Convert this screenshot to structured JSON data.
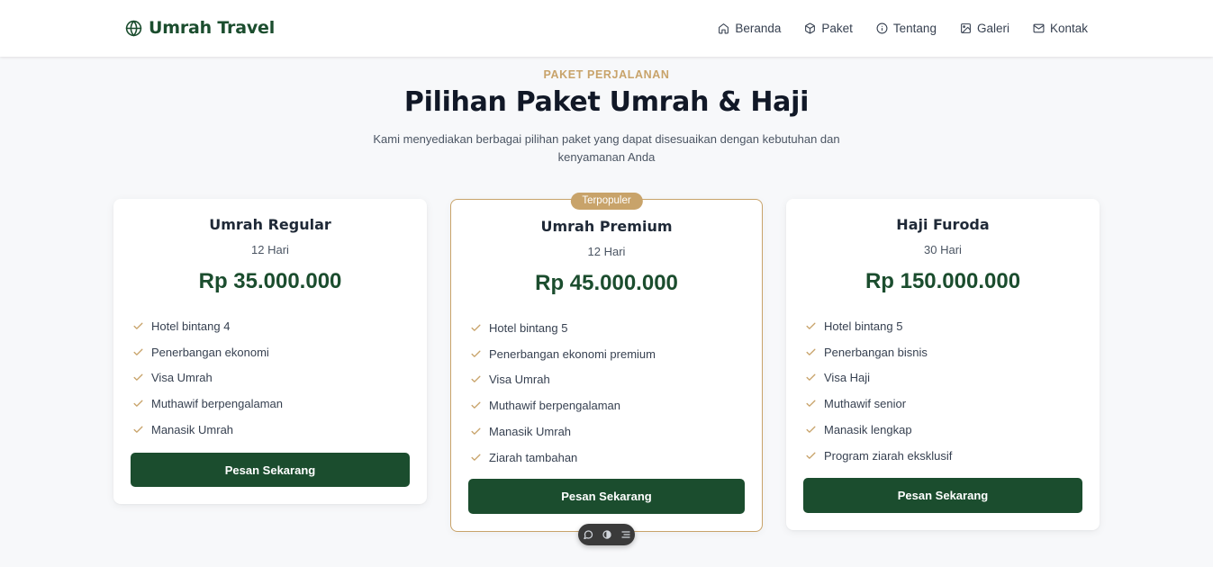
{
  "brand": {
    "name": "Umrah Travel",
    "icon": "globe-icon",
    "color": "#1b4d2e"
  },
  "nav": {
    "items": [
      {
        "label": "Beranda",
        "icon": "home-icon"
      },
      {
        "label": "Paket",
        "icon": "package-icon"
      },
      {
        "label": "Tentang",
        "icon": "info-icon"
      },
      {
        "label": "Galeri",
        "icon": "image-icon"
      },
      {
        "label": "Kontak",
        "icon": "mail-icon"
      }
    ]
  },
  "section": {
    "eyebrow": "PAKET PERJALANAN",
    "title": "Pilihan Paket Umrah & Haji",
    "subtitle": "Kami menyediakan berbagai pilihan paket yang dapat disesuaikan dengan kebutuhan dan kenyamanan Anda"
  },
  "packages": [
    {
      "title": "Umrah Regular",
      "duration": "12 Hari",
      "price": "Rp 35.000.000",
      "features": [
        "Hotel bintang 4",
        "Penerbangan ekonomi",
        "Visa Umrah",
        "Muthawif berpengalaman",
        "Manasik Umrah"
      ],
      "cta": "Pesan Sekarang"
    },
    {
      "title": "Umrah Premium",
      "badge": "Terpopuler",
      "duration": "12 Hari",
      "price": "Rp 45.000.000",
      "features": [
        "Hotel bintang 5",
        "Penerbangan ekonomi premium",
        "Visa Umrah",
        "Muthawif berpengalaman",
        "Manasik Umrah",
        "Ziarah tambahan"
      ],
      "cta": "Pesan Sekarang"
    },
    {
      "title": "Haji Furoda",
      "duration": "30 Hari",
      "price": "Rp 150.000.000",
      "features": [
        "Hotel bintang 5",
        "Penerbangan bisnis",
        "Visa Haji",
        "Muthawif senior",
        "Manasik lengkap",
        "Program ziarah eksklusif"
      ],
      "cta": "Pesan Sekarang"
    }
  ],
  "floating_toolbar": {
    "icons": [
      "comment-icon",
      "toggle-icon",
      "menu-icon"
    ]
  },
  "colors": {
    "primary": "#1b4d2e",
    "accent": "#c8a36a",
    "background": "#f7f8fa"
  }
}
